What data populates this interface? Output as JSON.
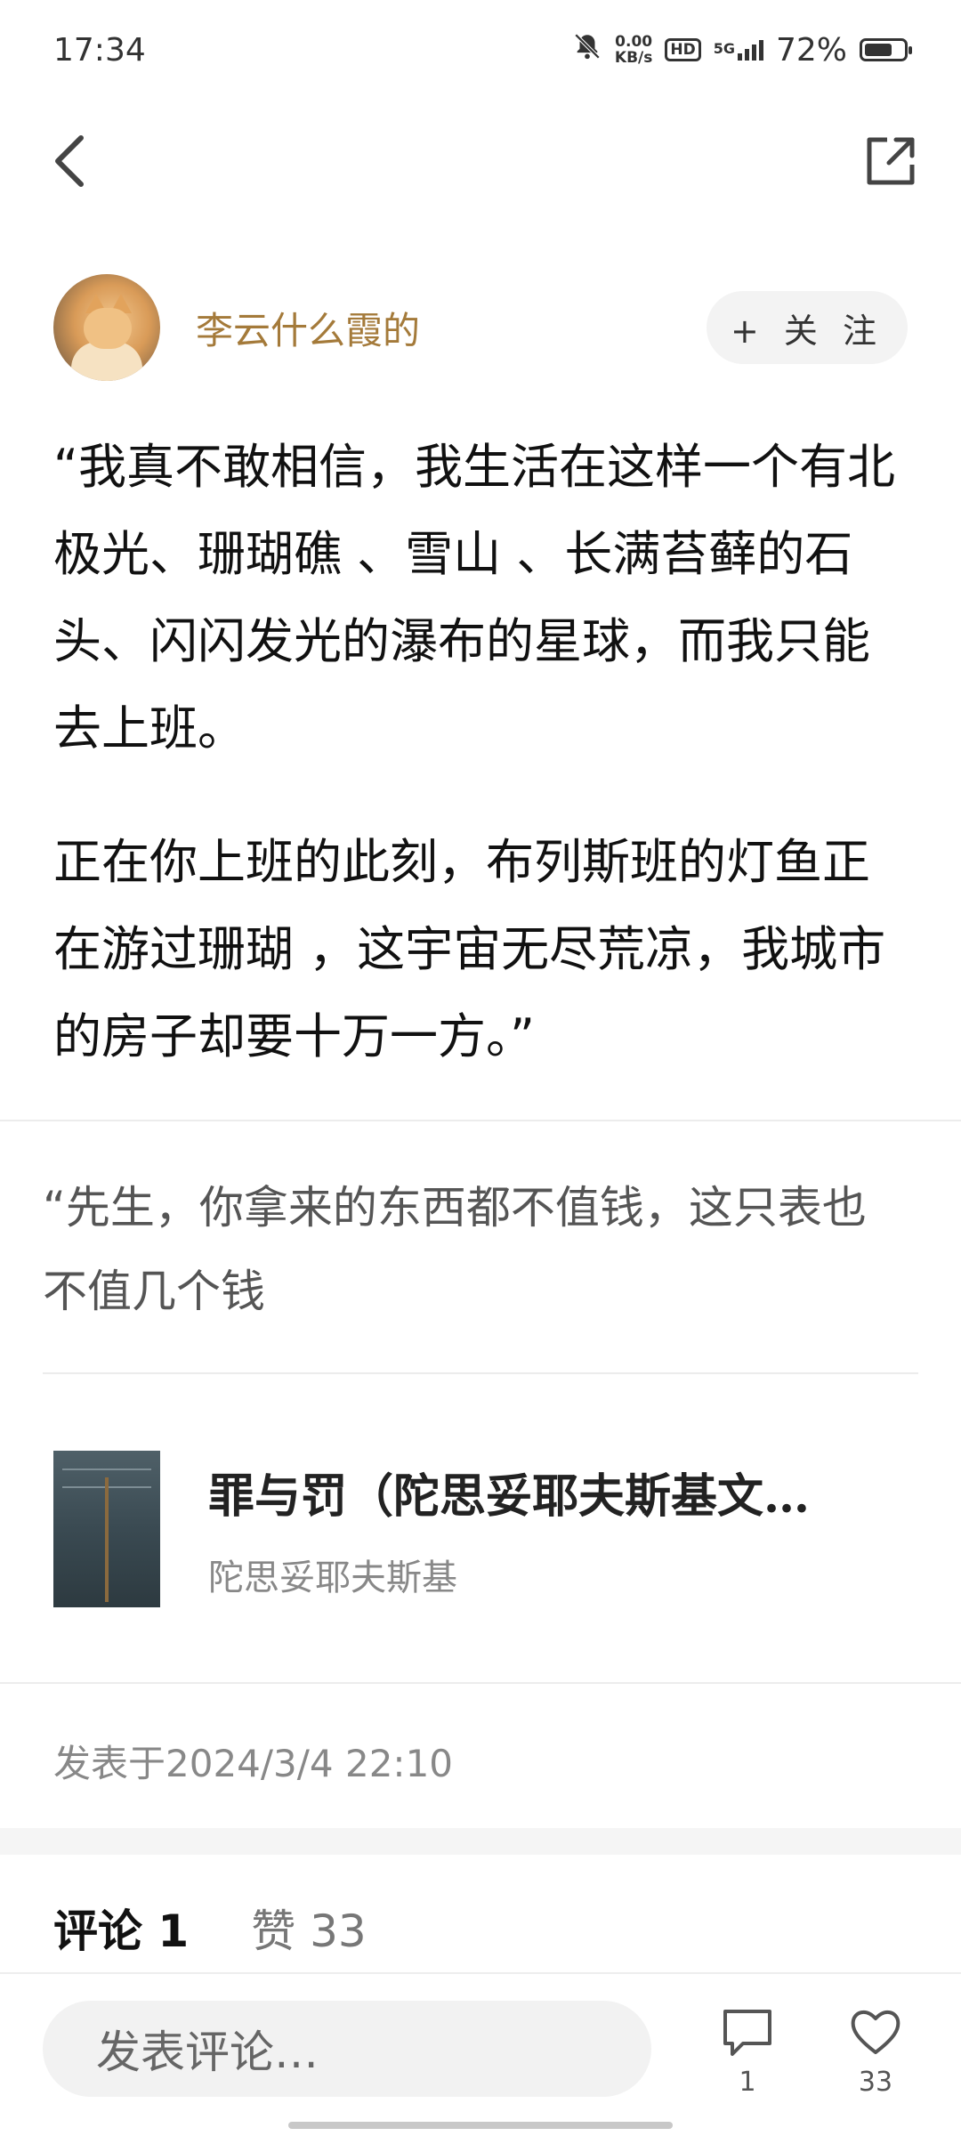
{
  "status_bar": {
    "time": "17:34",
    "net_speed_value": "0.00",
    "net_speed_unit": "KB/s",
    "hd_label": "HD",
    "network_label": "5G",
    "battery_percent": "72%",
    "battery_level": 0.72
  },
  "author": {
    "name": "李云什么霞的",
    "follow_label": "+ 关 注"
  },
  "post": {
    "paragraphs": [
      "“我真不敢相信，我生活在这样一个有北极光、珊瑚礁 、雪山 、长满苔藓的石头、闪闪发光的瀑布的星球，而我只能去上班。",
      "正在你上班的此刻，布列斯班的灯鱼正在游过珊瑚 ，这宇宙无尽荒凉，我城市的房子却要十万一方。”"
    ],
    "excerpt": "“先生，你拿来的东西都不值钱，这只表也不值几个钱",
    "time": "发表于2024/3/4 22:10"
  },
  "book": {
    "title": "罪与罚（陀思妥耶夫斯基文…",
    "author": "陀思妥耶夫斯基"
  },
  "tabs": {
    "comments": "评论 1",
    "likes": "赞 33"
  },
  "bottom_bar": {
    "comment_placeholder": "发表评论…",
    "comment_count": "1",
    "like_count": "33"
  },
  "icons": {
    "back": "chevron-left-icon",
    "share": "share-external-icon",
    "mute": "bell-off-icon",
    "comment": "speech-bubble-icon",
    "like": "heart-icon"
  }
}
